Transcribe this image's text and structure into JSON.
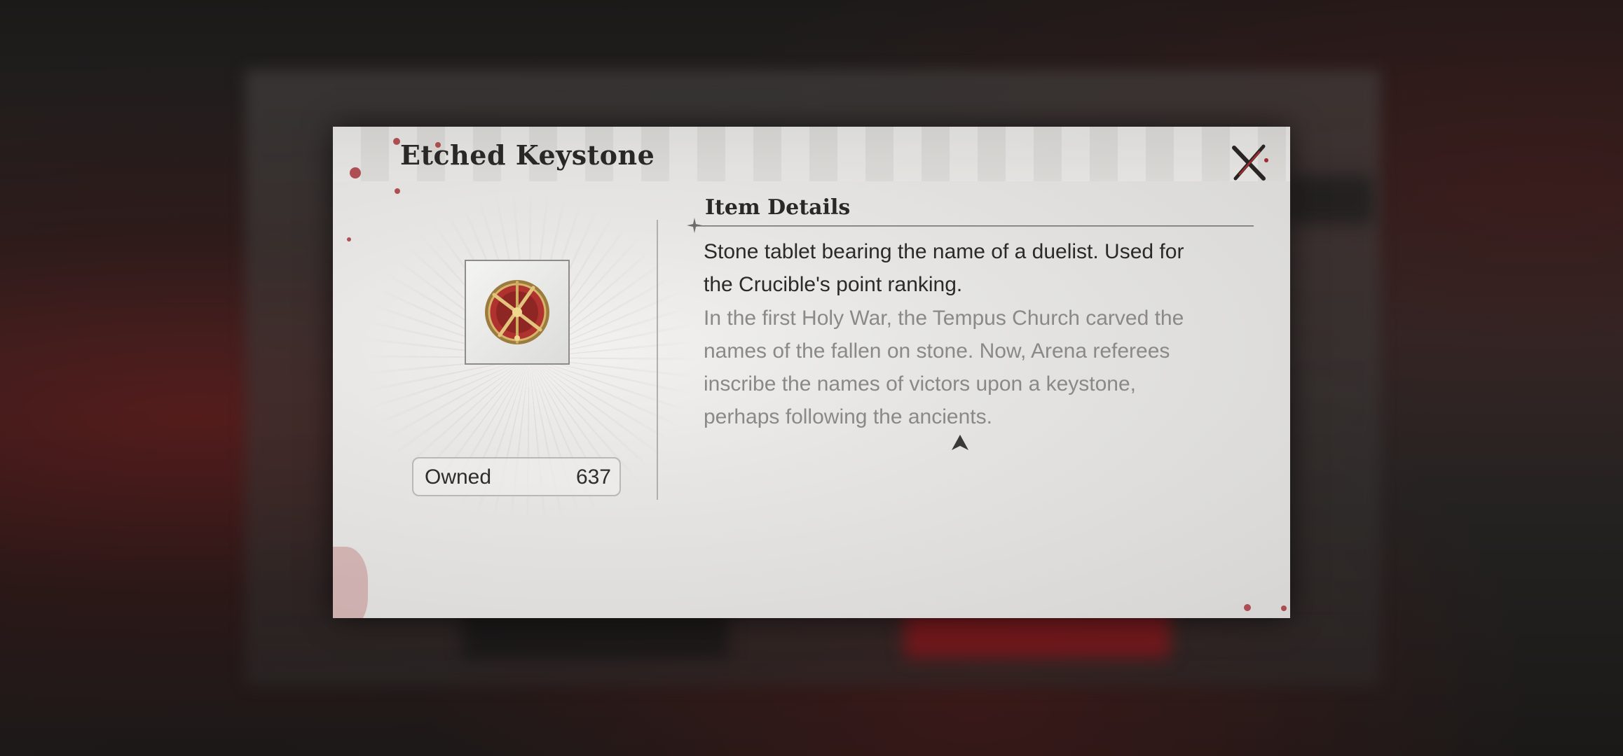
{
  "dialog": {
    "title": "Etched Keystone",
    "close_icon": "close-x-icon"
  },
  "item": {
    "icon": "keystone-emblem-icon",
    "owned_label": "Owned",
    "owned_count": "637"
  },
  "details": {
    "heading": "Item Details",
    "description": "Stone tablet bearing the name of a duelist. Used for the Crucible's point ranking.",
    "lore": "In the first Holy War, the Tempus Church carved the names of the fallen on stone. Now, Arena referees inscribe the names of victors upon a keystone, perhaps following the ancients.",
    "scroll_icon": "scroll-up-arrow-icon"
  },
  "colors": {
    "accent_red": "#a02a2f",
    "panel_bg": "#e6e5e3",
    "text_dark": "#2b2a28",
    "text_muted": "#8a8987"
  }
}
